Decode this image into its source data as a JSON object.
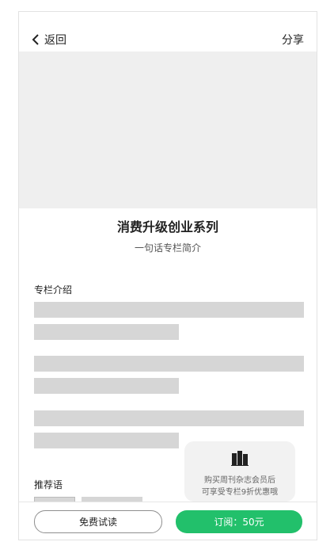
{
  "header": {
    "back_label": "返回",
    "share_label": "分享"
  },
  "column": {
    "title": "消费升级创业系列",
    "subtitle": "一句话专栏简介"
  },
  "sections": {
    "intro_heading": "专栏介绍",
    "recommend_heading": "推荐语"
  },
  "promo": {
    "icon": "book-icon",
    "line1": "购买周刊杂志会员后",
    "line2": "可享受专栏9折优惠哦"
  },
  "actions": {
    "trial_label": "免费试读",
    "subscribe_label": "订阅：50元"
  },
  "colors": {
    "accent": "#22c06b",
    "placeholder": "#d6d6d6",
    "cover": "#efefef"
  }
}
